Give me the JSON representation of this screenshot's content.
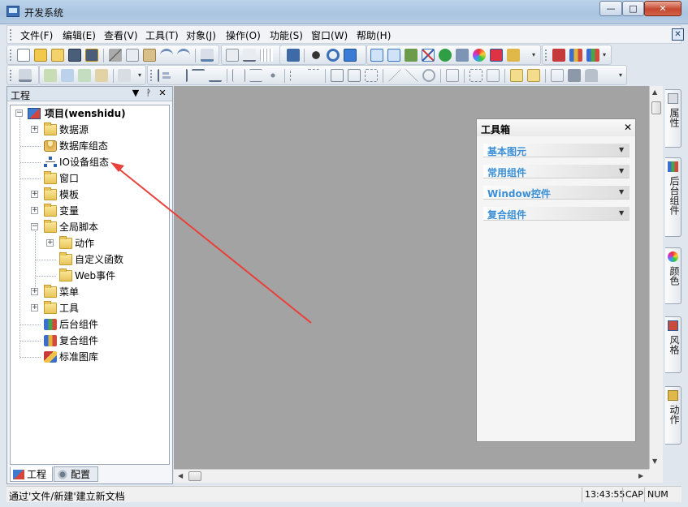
{
  "window": {
    "title": "开发系统",
    "minimize": "—",
    "maximize": "□",
    "close": "✕"
  },
  "menu": {
    "items": [
      "文件(F)",
      "编辑(E)",
      "查看(V)",
      "工具(T)",
      "对象(J)",
      "操作(O)",
      "功能(S)",
      "窗口(W)",
      "帮助(H)"
    ],
    "mdi_close": "✕"
  },
  "project_panel": {
    "title": "工程",
    "root": "项目(wenshidu)",
    "items": [
      {
        "label": "数据源",
        "icon": "folder-icon"
      },
      {
        "label": "数据库组态",
        "icon": "database-icon"
      },
      {
        "label": "IO设备组态",
        "icon": "network-icon"
      },
      {
        "label": "窗口",
        "icon": "folder-icon"
      },
      {
        "label": "模板",
        "icon": "folder-icon"
      },
      {
        "label": "变量",
        "icon": "folder-icon"
      },
      {
        "label": "全局脚本",
        "icon": "folder-icon"
      },
      {
        "label": "动作",
        "icon": "folder-icon"
      },
      {
        "label": "自定义函数",
        "icon": "folder-icon"
      },
      {
        "label": "Web事件",
        "icon": "folder-icon"
      },
      {
        "label": "菜单",
        "icon": "folder-icon"
      },
      {
        "label": "工具",
        "icon": "folder-icon"
      },
      {
        "label": "后台组件",
        "icon": "background-component-icon"
      },
      {
        "label": "复合组件",
        "icon": "composite-component-icon"
      },
      {
        "label": "标准图库",
        "icon": "standard-library-icon"
      }
    ],
    "tabs": [
      "工程",
      "配置"
    ]
  },
  "toolbox": {
    "title": "工具箱",
    "close": "✕",
    "groups": [
      "基本图元",
      "常用组件",
      "Window控件",
      "复合组件"
    ]
  },
  "right_tabs": [
    "属性",
    "后台组件",
    "颜色",
    "风格",
    "动作"
  ],
  "statusbar": {
    "message": "通过'文件/新建'建立新文档",
    "time": "13:43:55",
    "caps": "CAP",
    "num": "NUM"
  },
  "colors": {
    "accent_blue": "#3a8fd6",
    "workspace_gray": "#a3a3a3",
    "annotation_red": "#e8413b"
  }
}
